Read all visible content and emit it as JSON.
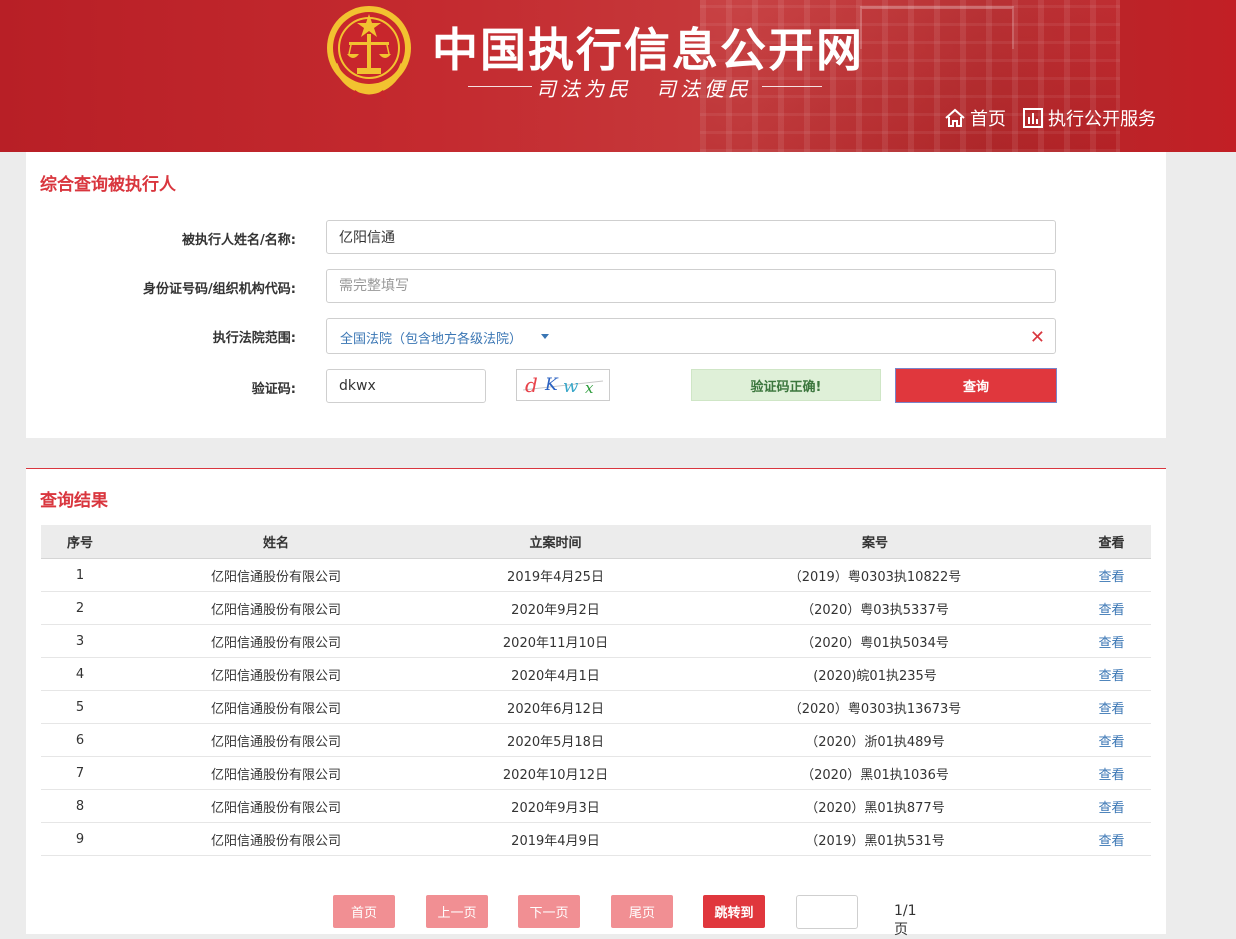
{
  "header": {
    "title": "中国执行信息公开网",
    "slogan": "司法为民　司法便民",
    "nav": [
      {
        "label": "首页",
        "icon": "home-icon"
      },
      {
        "label": "执行公开服务",
        "icon": "bar-chart-icon"
      }
    ],
    "colors": {
      "brand_red": "#c42a2f",
      "gold": "#f2c230"
    }
  },
  "search": {
    "title": "综合查询被执行人",
    "fields": {
      "name_label": "被执行人姓名/名称:",
      "name_value": "亿阳信通",
      "id_label": "身份证号码/组织机构代码:",
      "id_placeholder": "需完整填写",
      "court_label": "执行法院范围:",
      "court_value": "全国法院（包含地方各级法院）",
      "captcha_label": "验证码:",
      "captcha_value": "dkwx",
      "captcha_image_text": "dKwx"
    },
    "captcha_status": "验证码正确!",
    "submit_label": "查询"
  },
  "results": {
    "title": "查询结果",
    "columns": [
      "序号",
      "姓名",
      "立案时间",
      "案号",
      "查看"
    ],
    "rows": [
      {
        "no": "1",
        "name": "亿阳信通股份有限公司",
        "date": "2019年4月25日",
        "case": "（2019）粤0303执10822号",
        "view": "查看"
      },
      {
        "no": "2",
        "name": "亿阳信通股份有限公司",
        "date": "2020年9月2日",
        "case": "（2020）粤03执5337号",
        "view": "查看"
      },
      {
        "no": "3",
        "name": "亿阳信通股份有限公司",
        "date": "2020年11月10日",
        "case": "（2020）粤01执5034号",
        "view": "查看"
      },
      {
        "no": "4",
        "name": "亿阳信通股份有限公司",
        "date": "2020年4月1日",
        "case": "(2020)皖01执235号",
        "view": "查看"
      },
      {
        "no": "5",
        "name": "亿阳信通股份有限公司",
        "date": "2020年6月12日",
        "case": "（2020）粤0303执13673号",
        "view": "查看"
      },
      {
        "no": "6",
        "name": "亿阳信通股份有限公司",
        "date": "2020年5月18日",
        "case": "（2020）浙01执489号",
        "view": "查看"
      },
      {
        "no": "7",
        "name": "亿阳信通股份有限公司",
        "date": "2020年10月12日",
        "case": "（2020）黑01执1036号",
        "view": "查看"
      },
      {
        "no": "8",
        "name": "亿阳信通股份有限公司",
        "date": "2020年9月3日",
        "case": "（2020）黑01执877号",
        "view": "查看"
      },
      {
        "no": "9",
        "name": "亿阳信通股份有限公司",
        "date": "2019年4月9日",
        "case": "（2019）黑01执531号",
        "view": "查看"
      }
    ]
  },
  "pagination": {
    "first": "首页",
    "prev": "上一页",
    "next": "下一页",
    "last": "尾页",
    "jump": "跳转到",
    "jump_value": "",
    "page_info": "1/1页"
  }
}
